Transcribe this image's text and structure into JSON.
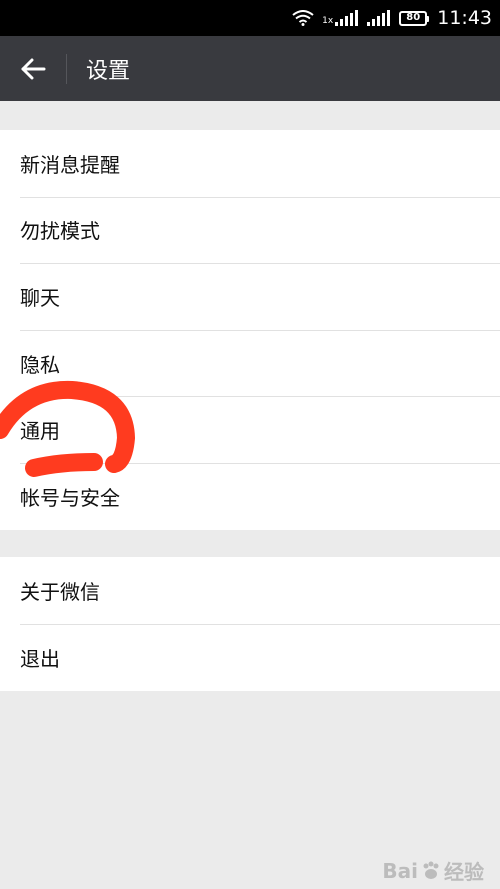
{
  "status_bar": {
    "signal_label": "1x",
    "battery": "80",
    "time": "11:43"
  },
  "header": {
    "title": "设置"
  },
  "menu": {
    "group1": [
      {
        "label": "新消息提醒"
      },
      {
        "label": "勿扰模式"
      },
      {
        "label": "聊天"
      },
      {
        "label": "隐私"
      },
      {
        "label": "通用"
      },
      {
        "label": "帐号与安全"
      }
    ],
    "group2": [
      {
        "label": "关于微信"
      },
      {
        "label": "退出"
      }
    ]
  },
  "watermark": {
    "text_a": "Bai",
    "text_b": "经验"
  },
  "colors": {
    "header_bg": "#393a3f",
    "page_bg": "#ebebeb",
    "annotation": "#ff3b1f"
  }
}
